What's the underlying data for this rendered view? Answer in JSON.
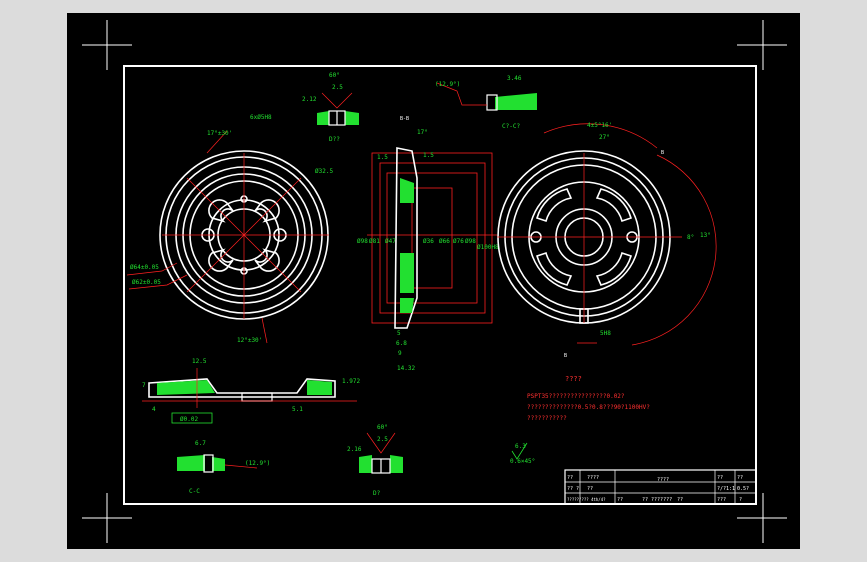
{
  "colors": {
    "background": "#dcdcdc",
    "sheet": "#000000",
    "outline": "#ffffff",
    "dimension": "#ff2020",
    "hatch": "#22e030"
  },
  "views": {
    "top_angle": "60°",
    "top_depth": "2.12",
    "top_width": "2.5",
    "top_note": "D??",
    "cc_angle": "(12.9°)",
    "cc_width": "3.46",
    "cc_label": "C?-C?",
    "section_bb": "B-B",
    "section_angle": "17°",
    "left_angle1": "17°±30'",
    "left_angle2": "12°±30'",
    "left_hole": "6xØ5H8",
    "left_dia1": "Ø64±0.05",
    "left_dia2": "Ø62±0.05",
    "left_ref": "Ø32.5",
    "right_angle1": "4±5°16'",
    "right_angle2": "27°",
    "right_angle3": "8°",
    "right_angle4": "13°",
    "right_b1": "B",
    "right_b2": "B",
    "right_hole": "5H8",
    "mid_dims": [
      "1.5",
      "1.5",
      "Ø98",
      "Ø81",
      "Ø47",
      "Ø36",
      "Ø66",
      "Ø76",
      "Ø98",
      "Ø100H8",
      "1.5",
      "5",
      "6.8",
      "9",
      "14.32"
    ],
    "bottom_left_dims": [
      "7",
      "Ø0.02",
      "12.5",
      "1.972",
      "4",
      "5.1"
    ],
    "bottom_cc_width": "6.7",
    "bottom_cc_angle": "(12.9°)",
    "bottom_cc_label": "C-C",
    "bottom_d_angle": "60°",
    "bottom_d_width": "2.5",
    "bottom_d_depth": "2.16",
    "bottom_d_label": "D?",
    "roughness": "6.3",
    "chamfer": "0.6×45°"
  },
  "notes": {
    "title": "????",
    "line1": "PSPT35????????????????0.02?",
    "line2": "??????????????0.5?0.8???90?1100HV?",
    "line3": "???????????"
  },
  "title_block": {
    "cells": [
      "??",
      "????",
      "????",
      "??",
      "??",
      "?? ?",
      "?/?1:1",
      "??",
      "0.5?",
      "??",
      "?? ???????",
      "???",
      "?",
      "?????/??? 4th/4?",
      "??"
    ]
  }
}
